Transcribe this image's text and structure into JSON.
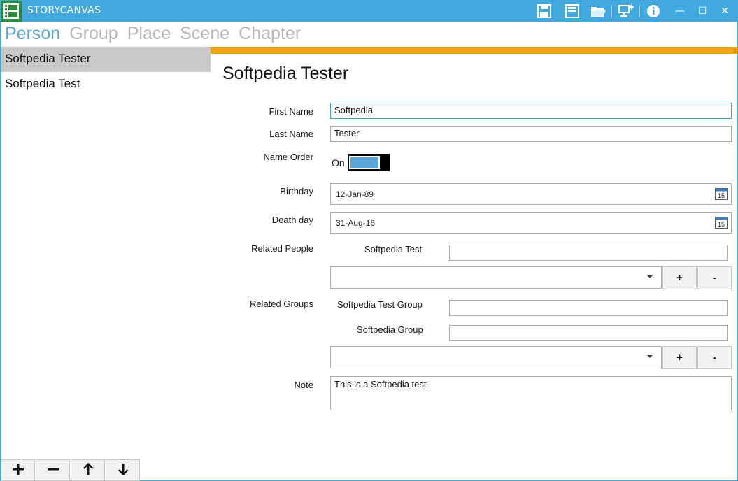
{
  "app": {
    "title": "STORYCANVAS"
  },
  "titlebar": {
    "icons": [
      "save-icon",
      "document-icon",
      "open-folder-icon",
      "export-icon",
      "info-icon"
    ],
    "window_controls": {
      "minimize": "—",
      "maximize": "☐",
      "close": "✕"
    }
  },
  "nav": {
    "tabs": [
      {
        "label": "Person",
        "active": true
      },
      {
        "label": "Group",
        "active": false
      },
      {
        "label": "Place",
        "active": false
      },
      {
        "label": "Scene",
        "active": false
      },
      {
        "label": "Chapter",
        "active": false
      }
    ]
  },
  "list": {
    "items": [
      {
        "label": "Softpedia Tester",
        "selected": true
      },
      {
        "label": "Softpedia  Test",
        "selected": false
      }
    ]
  },
  "bottom_buttons": [
    "plus-icon",
    "minus-icon",
    "arrow-up-icon",
    "arrow-down-icon"
  ],
  "detail": {
    "title": "Softpedia Tester",
    "first_name_label": "First Name",
    "first_name_value": "Softpedia",
    "last_name_label": "Last Name",
    "last_name_value": "Tester",
    "name_order_label": "Name Order",
    "name_order_state": "On",
    "birthday_label": "Birthday",
    "birthday_value": "12-Jan-89",
    "deathday_label": "Death day",
    "deathday_value": "31-Aug-16",
    "related_people_label": "Related People",
    "related_people": [
      {
        "name": "Softpedia  Test",
        "relation": ""
      }
    ],
    "related_groups_label": "Related Groups",
    "related_groups": [
      {
        "name": "Softpedia Test Group",
        "relation": ""
      },
      {
        "name": "Softpedia Group",
        "relation": ""
      }
    ],
    "add_label": "+",
    "remove_label": "-",
    "note_label": "Note",
    "note_value": "This is a Softpedia test",
    "calendar_day": "15"
  },
  "colors": {
    "titlebar": "#41a9df",
    "accent_tab": "#5aa6d8",
    "orange_bar": "#f2a500",
    "selected_item": "#c9c9c9"
  }
}
